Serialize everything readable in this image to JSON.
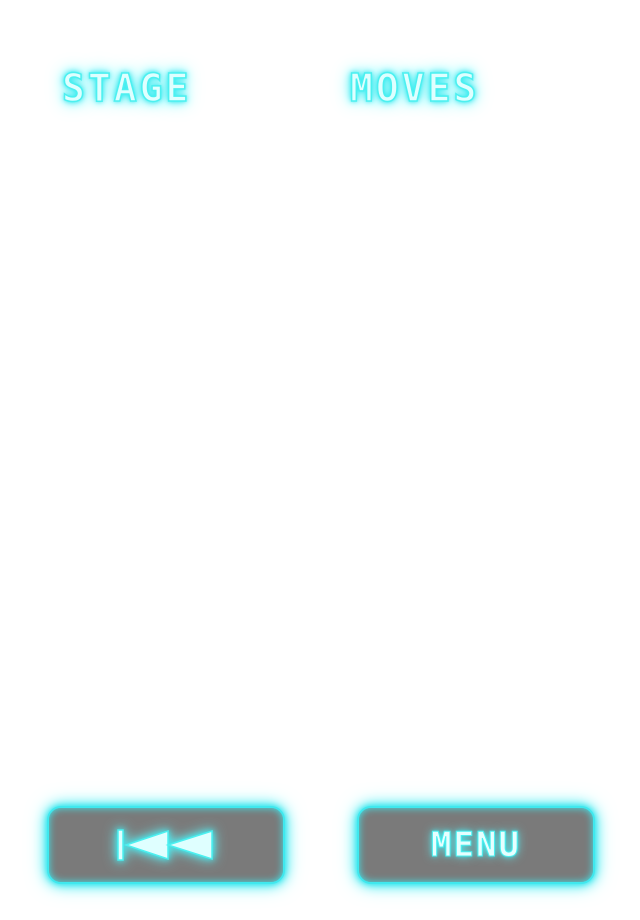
{
  "hud": {
    "stage_label": "STAGE",
    "moves_label": "MOVES"
  },
  "controls": {
    "restart_icon": "rewind-to-start-icon",
    "menu_label": "MENU"
  },
  "colors": {
    "neon_cyan": "#3fe8ee",
    "button_fill": "#7a7a7a",
    "background": "#ffffff"
  }
}
